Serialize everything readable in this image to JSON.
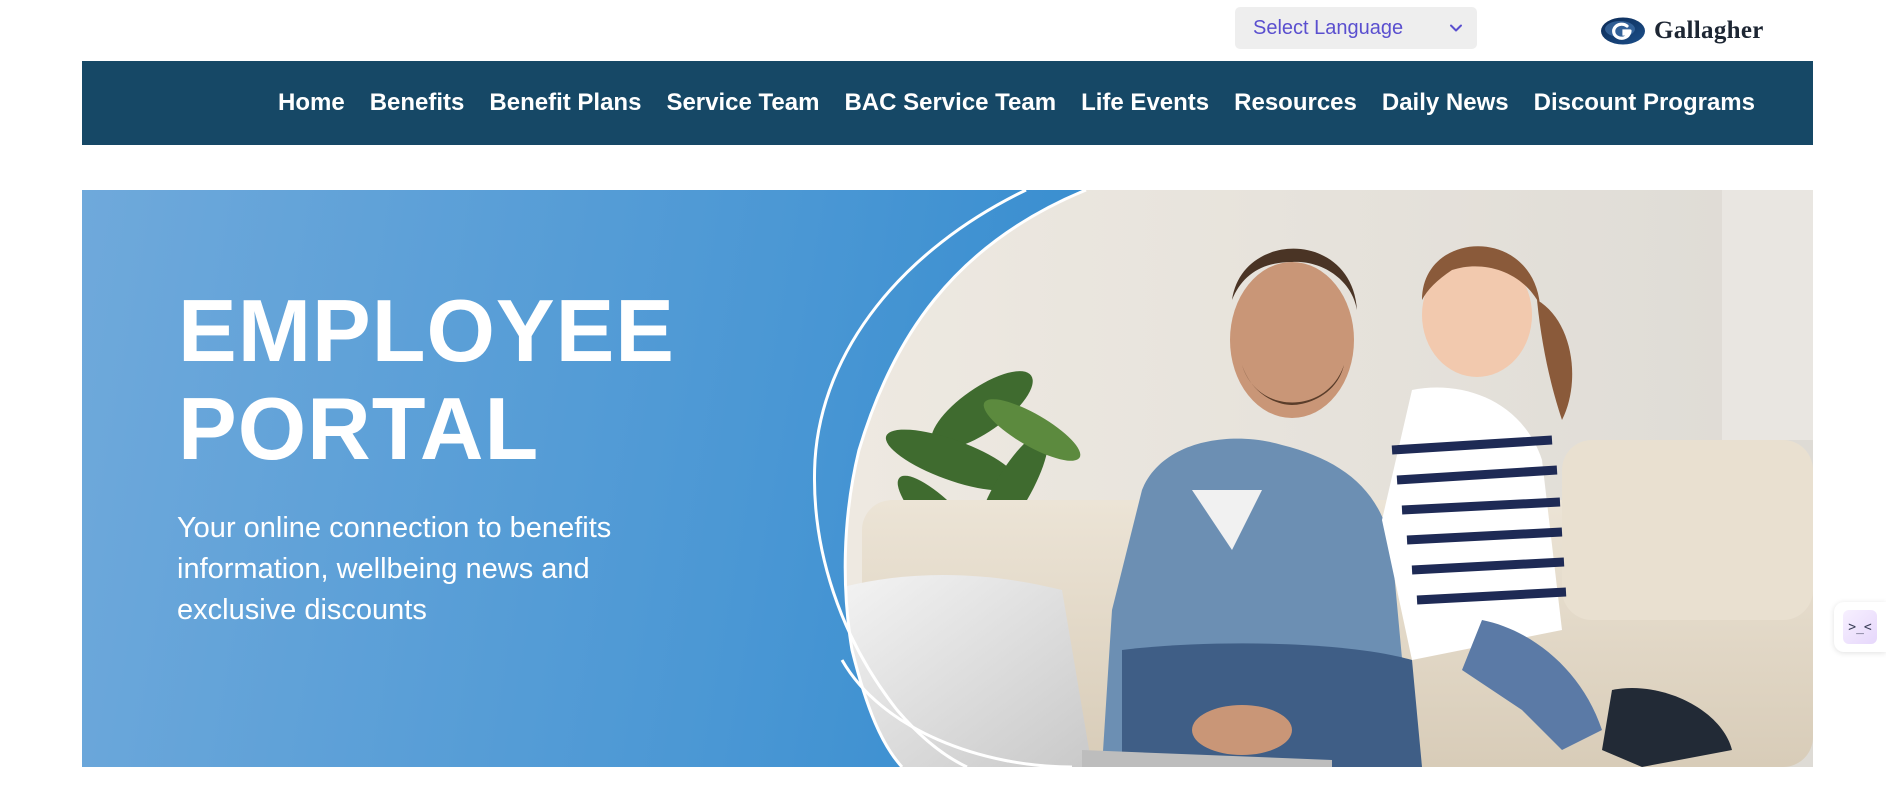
{
  "header": {
    "language_select": {
      "label": "Select Language",
      "icon": "chevron-down-icon"
    },
    "brand": {
      "name": "Gallagher",
      "icon": "gallagher-logo-icon"
    }
  },
  "nav": {
    "items": [
      {
        "label": "Home"
      },
      {
        "label": "Benefits"
      },
      {
        "label": "Benefit Plans"
      },
      {
        "label": "Service Team"
      },
      {
        "label": "BAC Service Team"
      },
      {
        "label": "Life Events"
      },
      {
        "label": "Resources"
      },
      {
        "label": "Daily News"
      },
      {
        "label": "Discount Programs"
      }
    ]
  },
  "hero": {
    "title_line1": "EMPLOYEE",
    "title_line2": "PORTAL",
    "subtitle": "Your online connection to benefits information, wellbeing news and exclusive discounts",
    "image_description_icon": "family-photo-icon"
  },
  "side_widget": {
    "icon": "chat-bot-icon",
    "glyph": ">_<"
  },
  "colors": {
    "nav_bg": "#164866",
    "hero_blue": "#2a86cc",
    "hero_blue_light": "#6fa9db",
    "language_text": "#5a4fcf",
    "brand_text": "#1d2633"
  }
}
